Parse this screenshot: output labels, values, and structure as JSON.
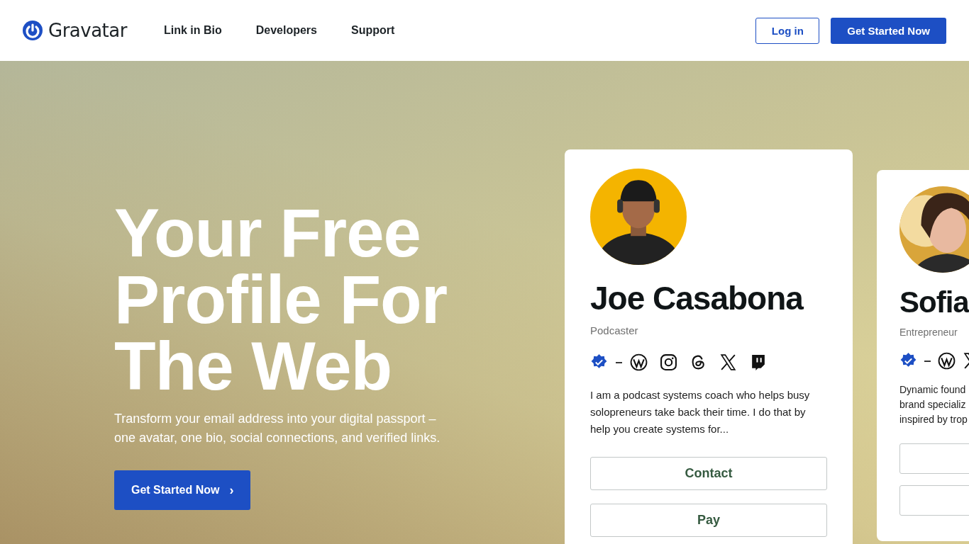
{
  "header": {
    "logo": "Gravatar",
    "nav": [
      "Link in Bio",
      "Developers",
      "Support"
    ],
    "login": "Log in",
    "cta": "Get Started Now"
  },
  "hero": {
    "headline": "Your Free Profile For The Web",
    "subtitle": "Transform your email address into your digital passport – one avatar, one bio, social connections, and verified links.",
    "cta": "Get Started Now",
    "cta_icon": "›"
  },
  "profiles": [
    {
      "name": "Joe Casabona",
      "role": "Podcaster",
      "avatar": {
        "kind": "picture"
      },
      "icons": [
        {
          "kind": "verified"
        },
        {
          "kind": "dash"
        },
        {
          "kind": "wordpress"
        },
        {
          "kind": "instagram"
        },
        {
          "kind": "threads"
        },
        {
          "kind": "x"
        },
        {
          "kind": "twitch"
        }
      ],
      "bio": [
        "I am a podcast systems coach who helps busy solopreneurs take back their time. I do that by help you create systems for..."
      ],
      "buttons": [
        {
          "kind": "outline",
          "label": "Contact"
        },
        {
          "kind": "outline",
          "label": "Pay"
        }
      ]
    },
    {
      "name": "Sofia",
      "role": "Entrepreneur",
      "avatar": {
        "kind": "picture"
      },
      "icons": [
        {
          "kind": "verified"
        },
        {
          "kind": "dash"
        },
        {
          "kind": "wordpress"
        },
        {
          "kind": "x"
        }
      ],
      "bio": [
        "Dynamic found",
        "brand specializ",
        "inspired by trop"
      ],
      "buttons": [
        {
          "kind": "outline"
        },
        {
          "kind": "outline"
        }
      ]
    }
  ]
}
